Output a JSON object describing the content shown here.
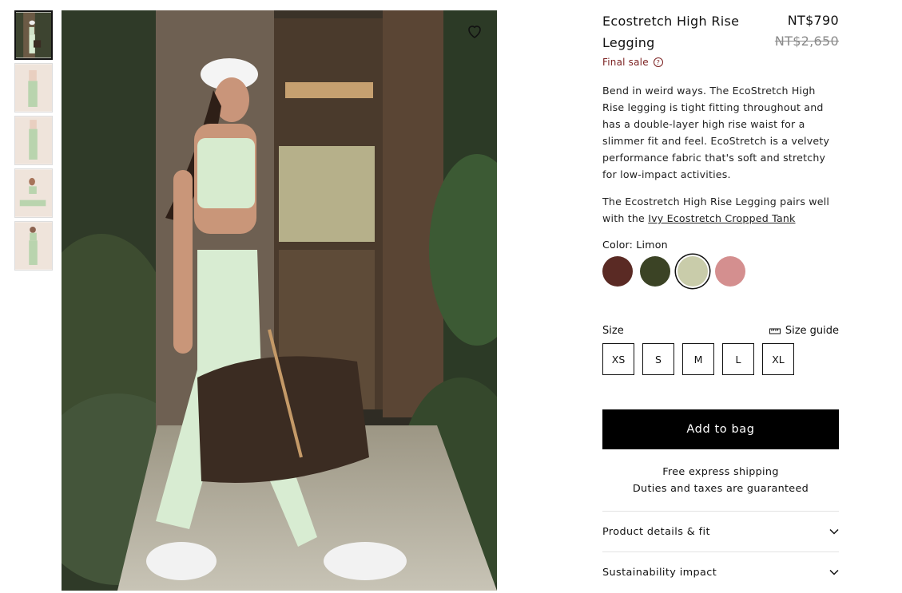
{
  "thumbnails": [
    {
      "name": "thumb-1"
    },
    {
      "name": "thumb-2"
    },
    {
      "name": "thumb-3"
    },
    {
      "name": "thumb-4"
    },
    {
      "name": "thumb-5"
    }
  ],
  "product": {
    "title": "Ecostretch High Rise Legging",
    "price": "NT$790",
    "old_price": "NT$2,650",
    "final_sale": "Final sale",
    "description": "Bend in weird ways. The EcoStretch High Rise legging is tight fitting throughout and has a double-layer high rise waist for a slimmer fit and feel. EcoStretch is a velvety performance fabric that's soft and stretchy for low-impact activities.",
    "pairs_prefix": "The Ecostretch High Rise Legging pairs well with the ",
    "pairs_link": "Ivy Ecostretch Cropped Tank",
    "color_label": "Color: Limon",
    "colors": [
      "#5a2a24",
      "#3b4325",
      "#c9ccaa",
      "#d48f8f"
    ],
    "size_label": "Size",
    "size_guide": "Size guide",
    "sizes": [
      "XS",
      "S",
      "M",
      "L",
      "XL"
    ],
    "add_to_bag": "Add to bag",
    "shipping_line1": "Free express shipping",
    "shipping_line2": "Duties and taxes are guaranteed",
    "accordion": [
      "Product details & fit",
      "Sustainability impact"
    ]
  },
  "icons": {
    "wishlist": "heart-icon",
    "help": "question-icon",
    "ruler": "ruler-icon",
    "chevron": "chevron-down-icon"
  }
}
